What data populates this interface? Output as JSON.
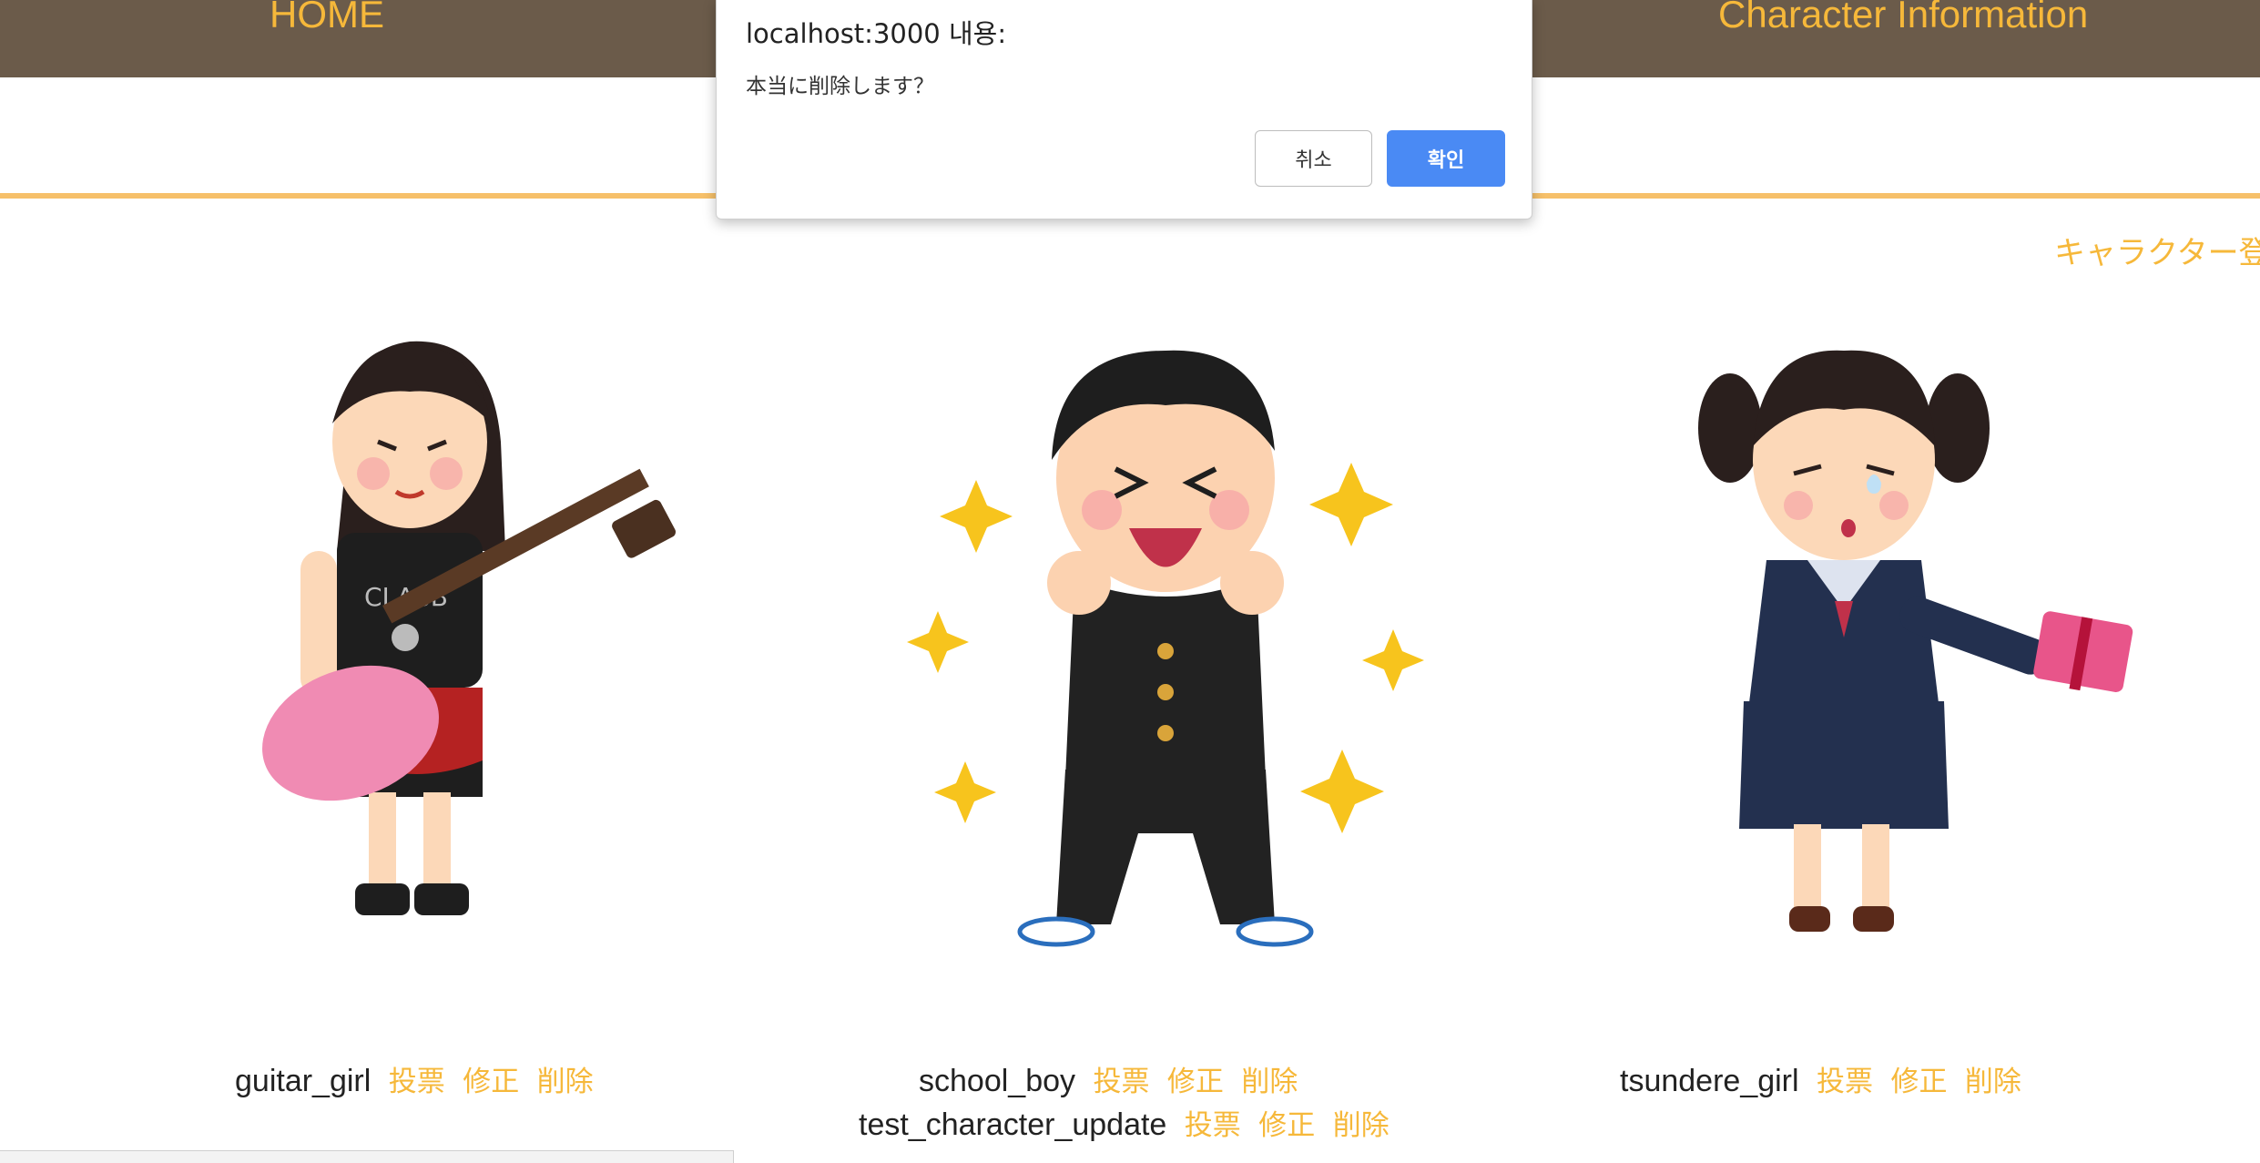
{
  "nav": {
    "home": "HOME",
    "character_info": "Character Information"
  },
  "register_link": "キャラクター登",
  "dialog": {
    "title": "localhost:3000 내용:",
    "message": "本当に削除します？",
    "cancel": "취소",
    "ok": "확인"
  },
  "characters": [
    {
      "name": "guitar_girl",
      "vote": "投票",
      "edit": "修正",
      "delete": "削除"
    },
    {
      "name": "school_boy",
      "vote": "投票",
      "edit": "修正",
      "delete": "削除"
    },
    {
      "name": "tsundere_girl",
      "vote": "投票",
      "edit": "修正",
      "delete": "削除"
    },
    {
      "name": "test_character_update",
      "vote": "投票",
      "edit": "修正",
      "delete": "削除"
    }
  ],
  "colors": {
    "navbar": "#6b5b4a",
    "accent": "#f6b83a",
    "rule": "#f6c06a",
    "ok_button": "#4a8af4"
  }
}
